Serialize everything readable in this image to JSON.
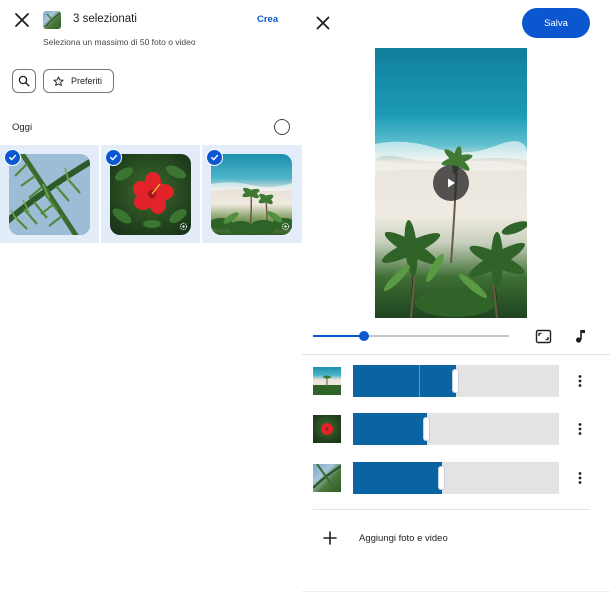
{
  "picker": {
    "title": "3 selezionati",
    "subtitle": "Seleziona un massimo di 50 foto o video",
    "create_label": "Crea",
    "favorites_label": "Preferiti",
    "section_label": "Oggi",
    "photos": [
      {
        "name": "palm-leaves",
        "selected": true
      },
      {
        "name": "red-hibiscus",
        "selected": true
      },
      {
        "name": "beach-palms",
        "selected": true
      }
    ]
  },
  "editor": {
    "save_label": "Salva",
    "playback_progress": 0.26,
    "clips": [
      {
        "name": "beach-palms",
        "trim_fraction": 0.5
      },
      {
        "name": "red-hibiscus",
        "trim_fraction": 0.36
      },
      {
        "name": "palm-leaves",
        "trim_fraction": 0.43
      }
    ],
    "add_label": "Aggiungi foto e video"
  },
  "colors": {
    "accent": "#0b57d0",
    "clip_fill": "#0a64a4",
    "selected_bg": "#e3ecf9"
  }
}
